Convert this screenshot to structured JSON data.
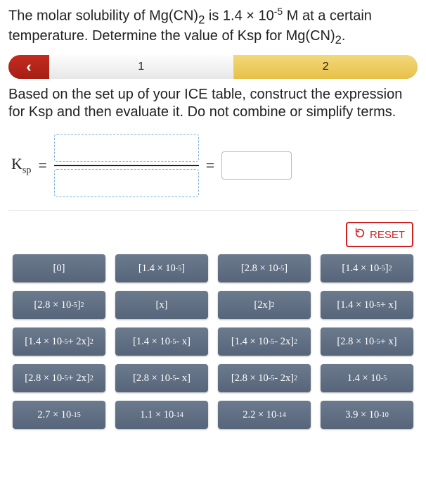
{
  "question_html": "The molar solubility of Mg(CN)<sub>2</sub> is 1.4 × 10<sup>-5</sup> M at a certain temperature. Determine the value of Ksp for Mg(CN)<sub>2</sub>.",
  "progress": {
    "back": "‹",
    "step1": "1",
    "step2": "2"
  },
  "instruction": "Based on the set up of your ICE table, construct the expression for Ksp and then evaluate it. Do not combine or simplify terms.",
  "ksp_html": "K<sub>sp</sub>",
  "equals": "=",
  "reset_label": "RESET",
  "tiles": [
    "[0]",
    "[1.4 × 10<sup>-5</sup>]",
    "[2.8 × 10<sup>-5</sup>]",
    "[1.4 × 10<sup>-5</sup>]<sup>2</sup>",
    "[2.8 × 10<sup>-5</sup>]<sup>2</sup>",
    "[x]",
    "[2x]<sup>2</sup>",
    "[1.4 × 10<sup>-5</sup> + x]",
    "[1.4 × 10<sup>-5</sup> + 2x]<sup>2</sup>",
    "[1.4 × 10<sup>-5</sup> - x]",
    "[1.4 × 10<sup>-5</sup> - 2x]<sup>2</sup>",
    "[2.8 × 10<sup>-5</sup> + x]",
    "[2.8 × 10<sup>-5</sup> + 2x]<sup>2</sup>",
    "[2.8 × 10<sup>-5</sup> - x]",
    "[2.8 × 10<sup>-5</sup> - 2x]<sup>2</sup>",
    "1.4 × 10<sup>-5</sup>",
    "2.7 × 10<sup>-15</sup>",
    "1.1 × 10<sup>-14</sup>",
    "2.2 × 10<sup>-14</sup>",
    "3.9 × 10<sup>-10</sup>"
  ]
}
